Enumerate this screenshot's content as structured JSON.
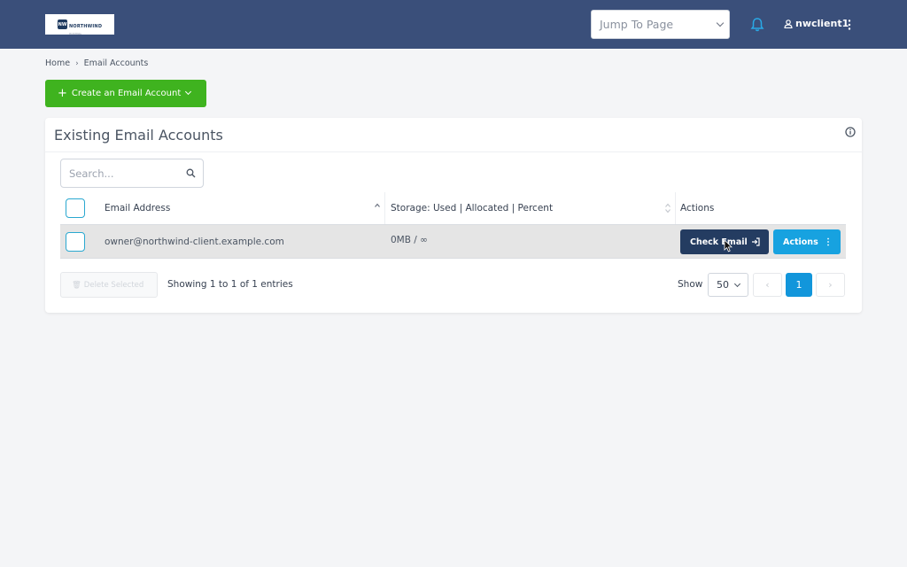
{
  "header": {
    "logo": {
      "brand": "NORTHWIND",
      "mark": "NW",
      "subtitle": "HOSTING"
    },
    "jump_placeholder": "Jump To Page",
    "username": "nwclient1"
  },
  "breadcrumb": {
    "home": "Home",
    "current": "Email Accounts"
  },
  "create_button": {
    "label": "Create an Email Account"
  },
  "panel": {
    "title": "Existing Email Accounts",
    "search_placeholder": "Search...",
    "columns": {
      "email": "Email Address",
      "storage": "Storage: Used | Allocated | Percent",
      "actions": "Actions"
    },
    "rows": [
      {
        "email": "owner@northwind-client.example.com",
        "storage": "0MB / ∞",
        "check_email": "Check Email",
        "actions": "Actions"
      }
    ],
    "delete_selected": "Delete Selected",
    "showing": "Showing 1 to 1 of 1 entries",
    "show_label": "Show",
    "per_page": "50",
    "pagination": {
      "prev": "‹",
      "current": "1",
      "next": "›"
    }
  },
  "colors": {
    "topbar": "#3a4f7a",
    "create_green": "#3fb31f",
    "check_email_navy": "#243c61",
    "actions_blue": "#17a2e0",
    "page_active": "#1296db",
    "checkbox_border": "#2aa8d0"
  },
  "icons": [
    "bell-icon",
    "user-icon",
    "kebab-icon",
    "chevron-right-icon",
    "plus-icon",
    "chevron-down-icon",
    "info-icon",
    "search-icon",
    "sort-icon",
    "sign-in-icon",
    "vertical-dots-icon",
    "trash-icon",
    "mouse-cursor-icon"
  ]
}
